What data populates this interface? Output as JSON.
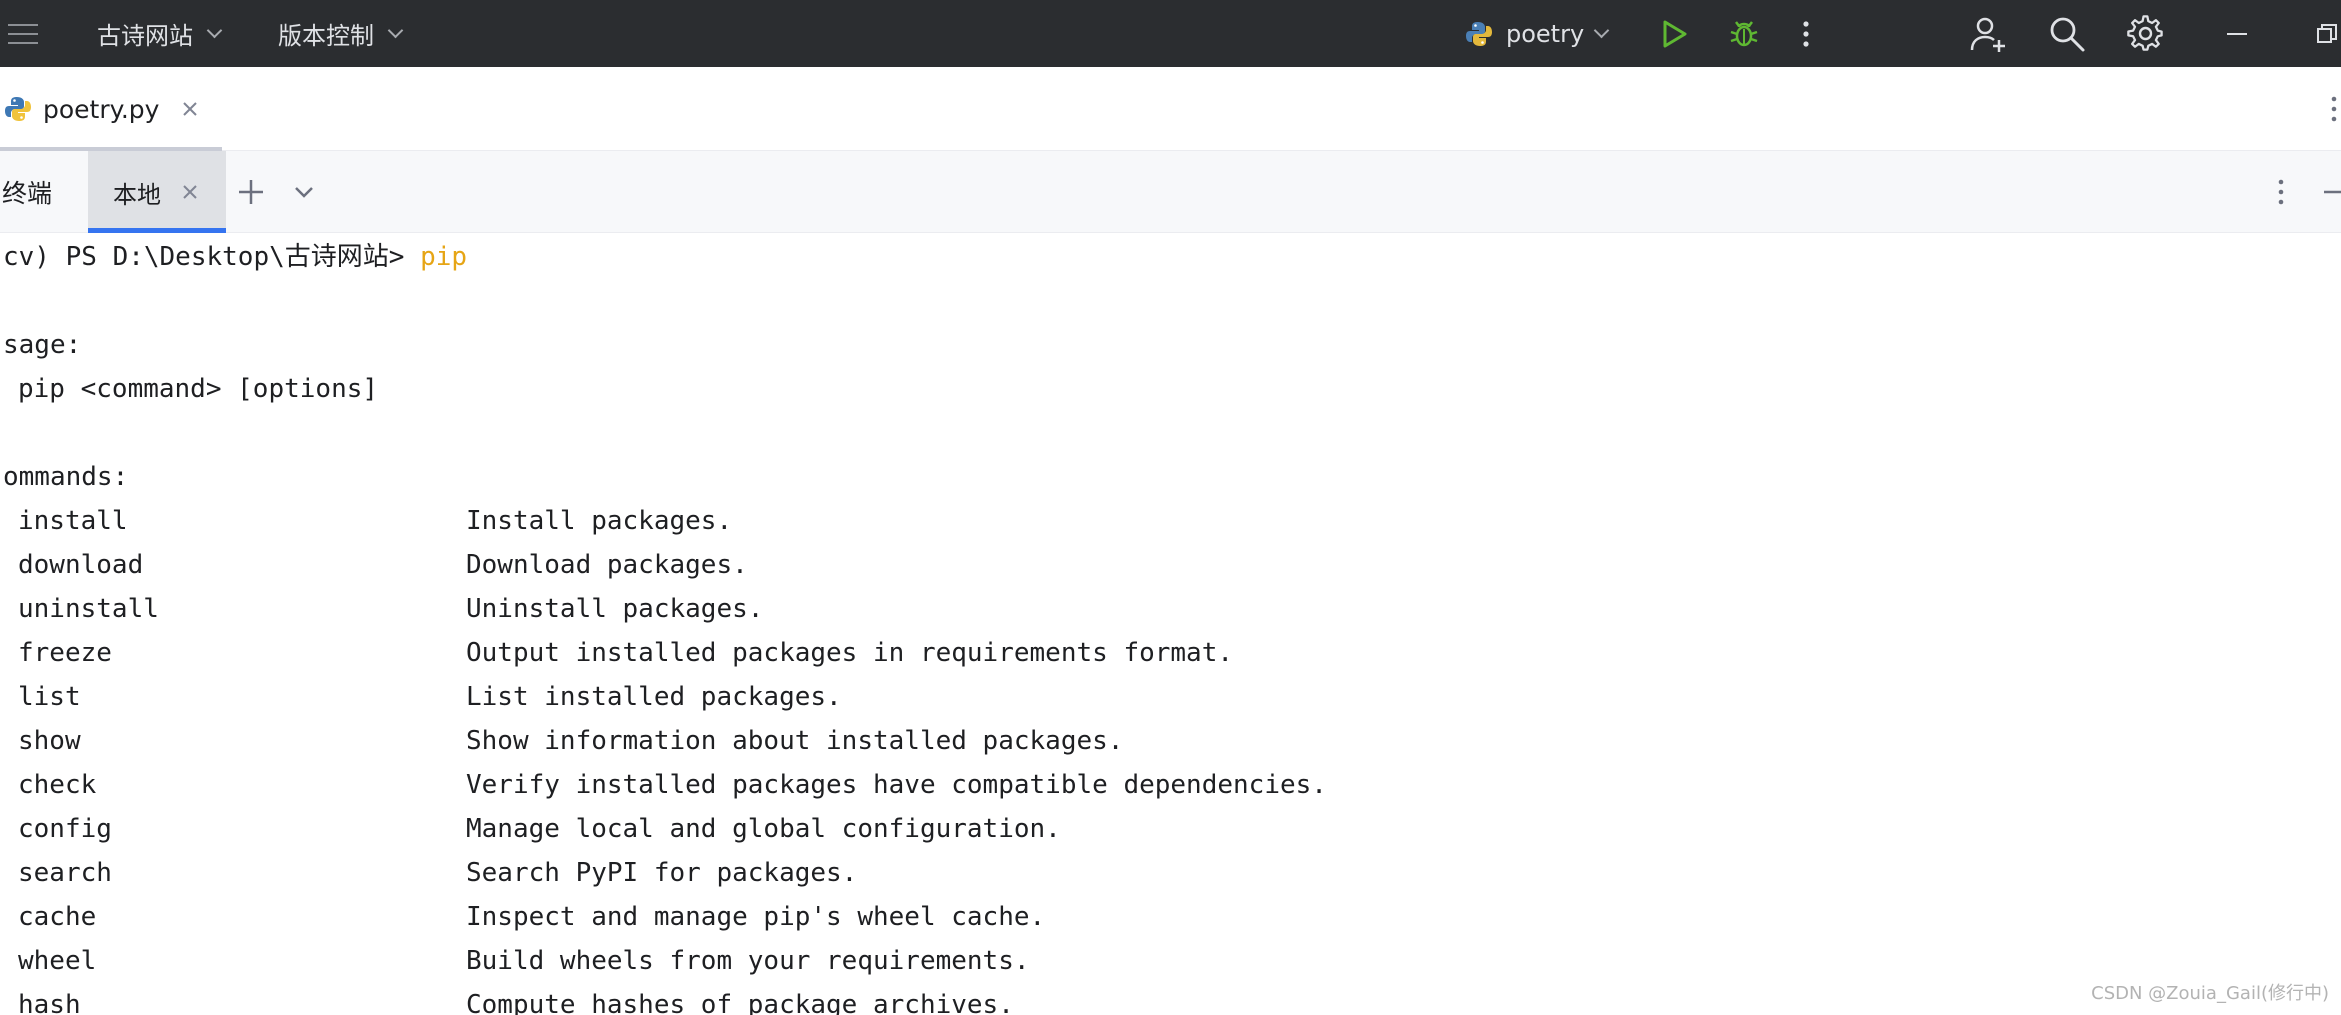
{
  "titlebar": {
    "project_name": "古诗网站",
    "vcs_label": "版本控制",
    "run_config": "poetry"
  },
  "editor": {
    "file_tab": "poetry.py"
  },
  "terminal": {
    "title": "终端",
    "local_tab": "本地",
    "prompt_prefix": "cv) PS D:\\Desktop\\古诗网站> ",
    "prompt_command": "pip",
    "usage_header": "sage:",
    "usage_line": "pip <command> [options]",
    "commands_header": "ommands:",
    "commands": [
      {
        "name": "install",
        "desc": "Install packages."
      },
      {
        "name": "download",
        "desc": "Download packages."
      },
      {
        "name": "uninstall",
        "desc": "Uninstall packages."
      },
      {
        "name": "freeze",
        "desc": "Output installed packages in requirements format."
      },
      {
        "name": "list",
        "desc": "List installed packages."
      },
      {
        "name": "show",
        "desc": "Show information about installed packages."
      },
      {
        "name": "check",
        "desc": "Verify installed packages have compatible dependencies."
      },
      {
        "name": "config",
        "desc": "Manage local and global configuration."
      },
      {
        "name": "search",
        "desc": "Search PyPI for packages."
      },
      {
        "name": "cache",
        "desc": "Inspect and manage pip's wheel cache."
      },
      {
        "name": "wheel",
        "desc": "Build wheels from your requirements."
      },
      {
        "name": "hash",
        "desc": "Compute hashes of package archives."
      }
    ]
  },
  "watermark": "CSDN @Zouia_Gail(修行中)",
  "colors": {
    "titlebar_bg": "#2b2d30",
    "accent_blue": "#3574f0",
    "run_green": "#5fb832",
    "prompt_command": "#e6a515"
  },
  "icons": [
    "hamburger-menu-icon",
    "python-icon",
    "run-icon",
    "debug-icon",
    "more-vertical-icon",
    "add-user-icon",
    "search-icon",
    "settings-icon",
    "minimize-icon",
    "restore-icon",
    "close-icon",
    "plus-icon",
    "chevron-down-icon"
  ]
}
